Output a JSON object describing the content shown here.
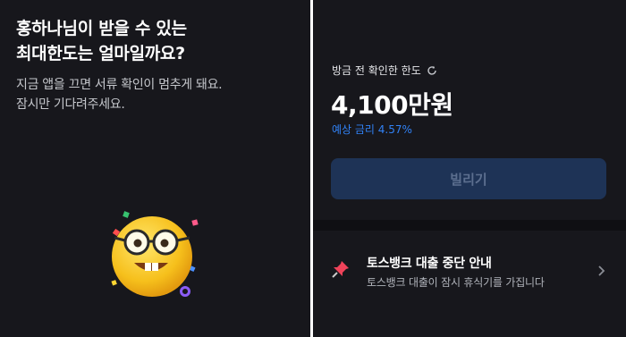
{
  "left_panel": {
    "title_line1": "홍하나님이 받을 수 있는",
    "title_line2": "최대한도는 얼마일까요?",
    "subtitle_line1": "지금 앱을 끄면 서류 확인이 멈추게 돼요.",
    "subtitle_line2": "잠시만 기다려주세요.",
    "illustration": "nerd-face-emoji-with-confetti"
  },
  "right_panel": {
    "limit_label": "방금 전 확인한 한도",
    "refresh_icon": "refresh-icon",
    "amount": "4,100만원",
    "rate": "예상 금리 4.57%",
    "borrow_button": "빌리기",
    "notice": {
      "title": "토스뱅크 대출 중단 안내",
      "description": "토스뱅크 대출이 잠시 휴식기를 가집니다",
      "icon": "pushpin-icon"
    }
  },
  "colors": {
    "background": "#17171c",
    "accent_blue": "#3182f6",
    "button_bg": "#1e3356",
    "button_text": "#5c6f8f"
  }
}
